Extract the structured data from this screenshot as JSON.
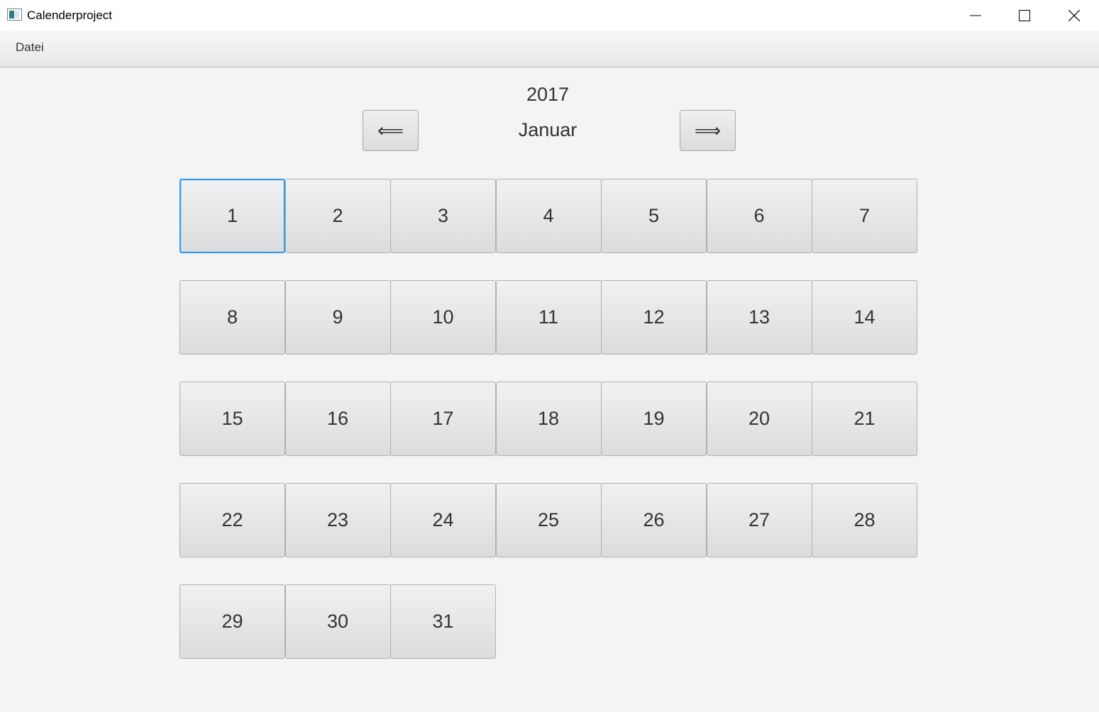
{
  "window": {
    "title": "Calenderproject",
    "controls": [
      "minimize-icon",
      "maximize-icon",
      "close-icon"
    ]
  },
  "menubar": {
    "items": [
      {
        "label": "Datei"
      }
    ]
  },
  "calendar": {
    "year": "2017",
    "month": "Januar",
    "prev_label": "⟸",
    "next_label": "⟹",
    "selected_day": "1",
    "weeks": [
      [
        "1",
        "2",
        "3",
        "4",
        "5",
        "6",
        "7"
      ],
      [
        "8",
        "9",
        "10",
        "11",
        "12",
        "13",
        "14"
      ],
      [
        "15",
        "16",
        "17",
        "18",
        "19",
        "20",
        "21"
      ],
      [
        "22",
        "23",
        "24",
        "25",
        "26",
        "27",
        "28"
      ],
      [
        "29",
        "30",
        "31"
      ]
    ]
  },
  "colors": {
    "selection_border": "#2f9ae5",
    "background": "#f4f4f4"
  }
}
